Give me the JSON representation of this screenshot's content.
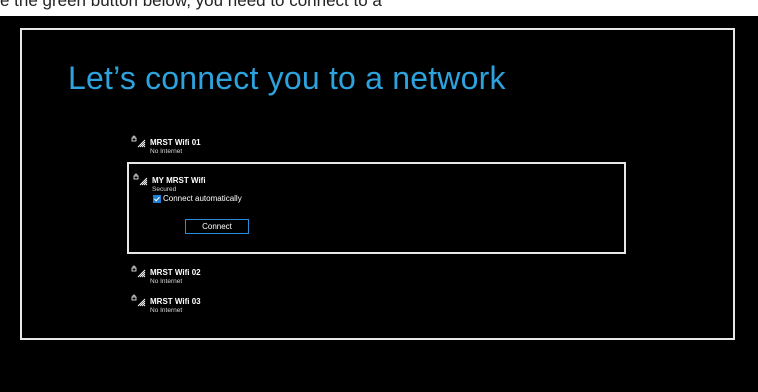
{
  "top_strip_text": "e the green button below, you need to connect to a",
  "page_title": "Let’s connect you to a network",
  "networks": [
    {
      "name": "MRST Wifi 01",
      "status": "No Internet"
    },
    {
      "name": "MY MRST Wifi",
      "status": "Secured"
    },
    {
      "name": "MRST Wifi 02",
      "status": "No Internet"
    },
    {
      "name": "MRST Wifi 03",
      "status": "No Internet"
    }
  ],
  "selected_network": {
    "auto_connect_label": "Connect automatically",
    "auto_connect_checked": true,
    "connect_button_label": "Connect"
  },
  "colors": {
    "accent": "#2ea2dd",
    "background": "#000000",
    "checkbox": "#1f7fd6"
  },
  "icons": {
    "network": "wifi-secured-icon",
    "check": "checkmark-icon"
  }
}
